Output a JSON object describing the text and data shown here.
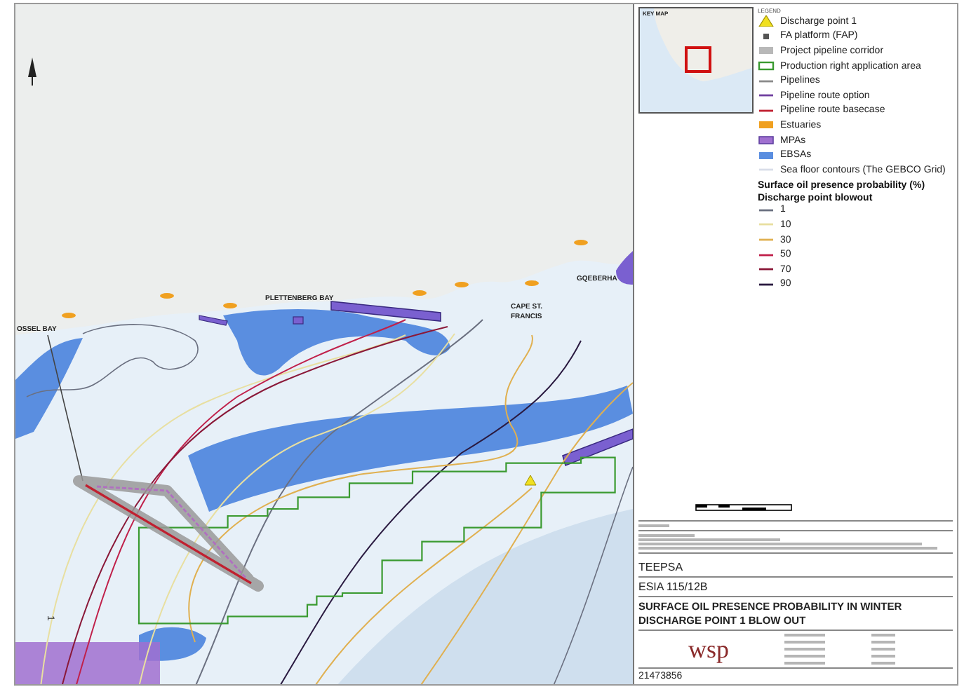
{
  "map": {
    "places": [
      {
        "label": "PLETTENBERG BAY"
      },
      {
        "label": "CAPE ST."
      },
      {
        "label": "FRANCIS"
      },
      {
        "label": "GQEBERHA"
      },
      {
        "label": "OSSEL BAY"
      }
    ],
    "contour_label": "1"
  },
  "inset": {
    "title": "KEY MAP"
  },
  "legend": {
    "title": "LEGEND",
    "items": [
      {
        "kind": "triangle",
        "label": "Discharge point 1",
        "color": "#f0e020"
      },
      {
        "kind": "square",
        "label": "FA platform (FAP)",
        "color": "#555555"
      },
      {
        "kind": "patch",
        "label": "Project pipeline corridor",
        "color": "#b8b8b8"
      },
      {
        "kind": "outline",
        "label": "Production right application area",
        "color": "#3a9a30"
      },
      {
        "kind": "line",
        "label": "Pipelines",
        "color": "#8a8a8a"
      },
      {
        "kind": "line",
        "label": "Pipeline route option",
        "color": "#7040a0"
      },
      {
        "kind": "line",
        "label": "Pipeline route basecase",
        "color": "#c02030"
      },
      {
        "kind": "patch",
        "label": "Estuaries",
        "color": "#f0a020"
      },
      {
        "kind": "outlined-patch",
        "label": "MPAs",
        "color": "#a070d0"
      },
      {
        "kind": "patch",
        "label": "EBSAs",
        "color": "#5a8ee0"
      },
      {
        "kind": "line",
        "label": "Sea floor contours (The GEBCO Grid)",
        "color": "#d8dde8"
      }
    ],
    "subtitle": "Surface oil presence probability (%)",
    "group": "Discharge point blowout",
    "contours": [
      {
        "label": "1",
        "color": "#6b7080"
      },
      {
        "label": "10",
        "color": "#e8dfa0"
      },
      {
        "label": "30",
        "color": "#e0b050"
      },
      {
        "label": "50",
        "color": "#c0204a"
      },
      {
        "label": "70",
        "color": "#8a1838"
      },
      {
        "label": "90",
        "color": "#2a1a40"
      }
    ]
  },
  "title_block": {
    "client": "TEEPSA",
    "project": "ESIA 115/12B",
    "title": [
      "SURFACE OIL PRESENCE PROBABILITY IN WINTER",
      "DISCHARGE POINT 1 BLOW OUT"
    ],
    "logo": "wsp",
    "project_no": "21473856"
  }
}
